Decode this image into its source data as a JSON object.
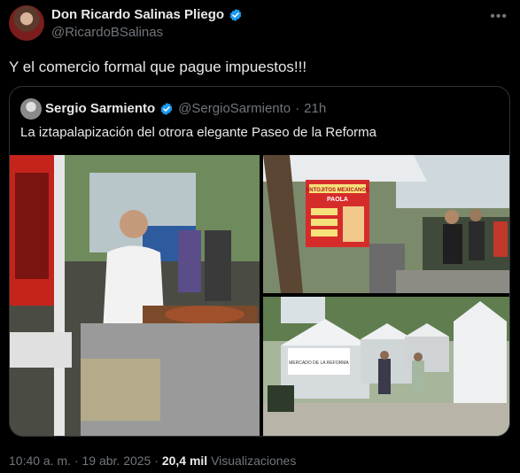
{
  "author": {
    "name": "Don Ricardo Salinas Pliego",
    "handle": "@RicardoBSalinas"
  },
  "tweet": {
    "text": "Y el comercio formal que pague impuestos!!!"
  },
  "quoted": {
    "name": "Sergio Sarmiento",
    "handle": "@SergioSarmiento",
    "separator": "·",
    "time": "21h",
    "text": "La iztapalapización del otrora elegante Paseo de la Reforma"
  },
  "media": {
    "sign_line1": "ANTOJITOS MEXICANOS",
    "sign_line2": "PAOLA",
    "banner_text": "MERCADO DE LA REFORMA"
  },
  "footer": {
    "time": "10:40 a. m.",
    "sep1": "·",
    "date": "19 abr. 2025",
    "sep2": "·",
    "views": "20,4 mil",
    "views_label": "Visualizaciones"
  },
  "colors": {
    "verified": "#1d9bf0",
    "muted": "#71767b",
    "text": "#e7e9ea"
  }
}
